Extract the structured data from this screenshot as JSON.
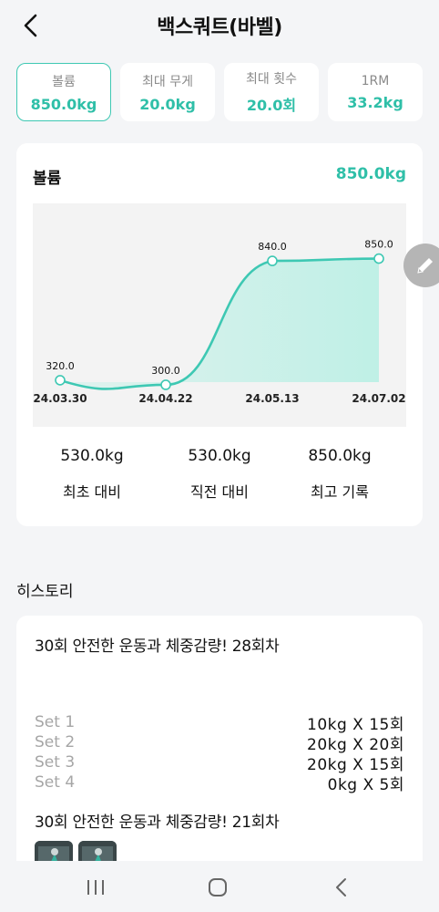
{
  "header": {
    "title": "백스쿼트(바벨)"
  },
  "stat_tabs": [
    {
      "label": "볼륨",
      "value": "850.0kg",
      "active": true
    },
    {
      "label": "최대 무게",
      "value": "20.0kg",
      "active": false
    },
    {
      "label": "최대 횟수",
      "value": "20.0회",
      "active": false
    },
    {
      "label": "1RM",
      "value": "33.2kg",
      "active": false
    }
  ],
  "main_card": {
    "title": "볼륨",
    "value": "850.0kg",
    "summary": [
      {
        "value": "530.0kg",
        "label": "최초 대비"
      },
      {
        "value": "530.0kg",
        "label": "직전 대비"
      },
      {
        "value": "850.0kg",
        "label": "최고 기록"
      }
    ]
  },
  "chart_data": {
    "type": "area",
    "categories": [
      "24.03.30",
      "24.04.22",
      "24.05.13",
      "24.07.02"
    ],
    "values": [
      320.0,
      300.0,
      840.0,
      850.0
    ],
    "point_labels": [
      "320.0",
      "300.0",
      "840.0",
      "850.0"
    ],
    "title": "",
    "xlabel": "",
    "ylabel": "",
    "grid": false,
    "colors": {
      "line": "#3ec8b3",
      "fill": "#bff0e6",
      "background": "#f3f3f3"
    }
  },
  "history": {
    "section_title": "히스토리",
    "sessions": [
      {
        "title": "30회 안전한 운동과 체중감량! 28회차",
        "sets": [
          {
            "label": "Set 1",
            "value": "10kg  X  15회"
          },
          {
            "label": "Set 2",
            "value": "20kg  X  20회"
          },
          {
            "label": "Set 3",
            "value": "20kg  X  15회"
          },
          {
            "label": "Set 4",
            "value": "0kg  X  5회"
          }
        ]
      },
      {
        "title": "30회 안전한 운동과 체중감량! 21회차",
        "sets": []
      }
    ]
  },
  "icons": {
    "back": "chevron-left-icon",
    "edit": "pencil-icon",
    "nav_recent": "recent-apps-icon",
    "nav_home": "home-icon",
    "nav_back": "nav-back-icon"
  }
}
